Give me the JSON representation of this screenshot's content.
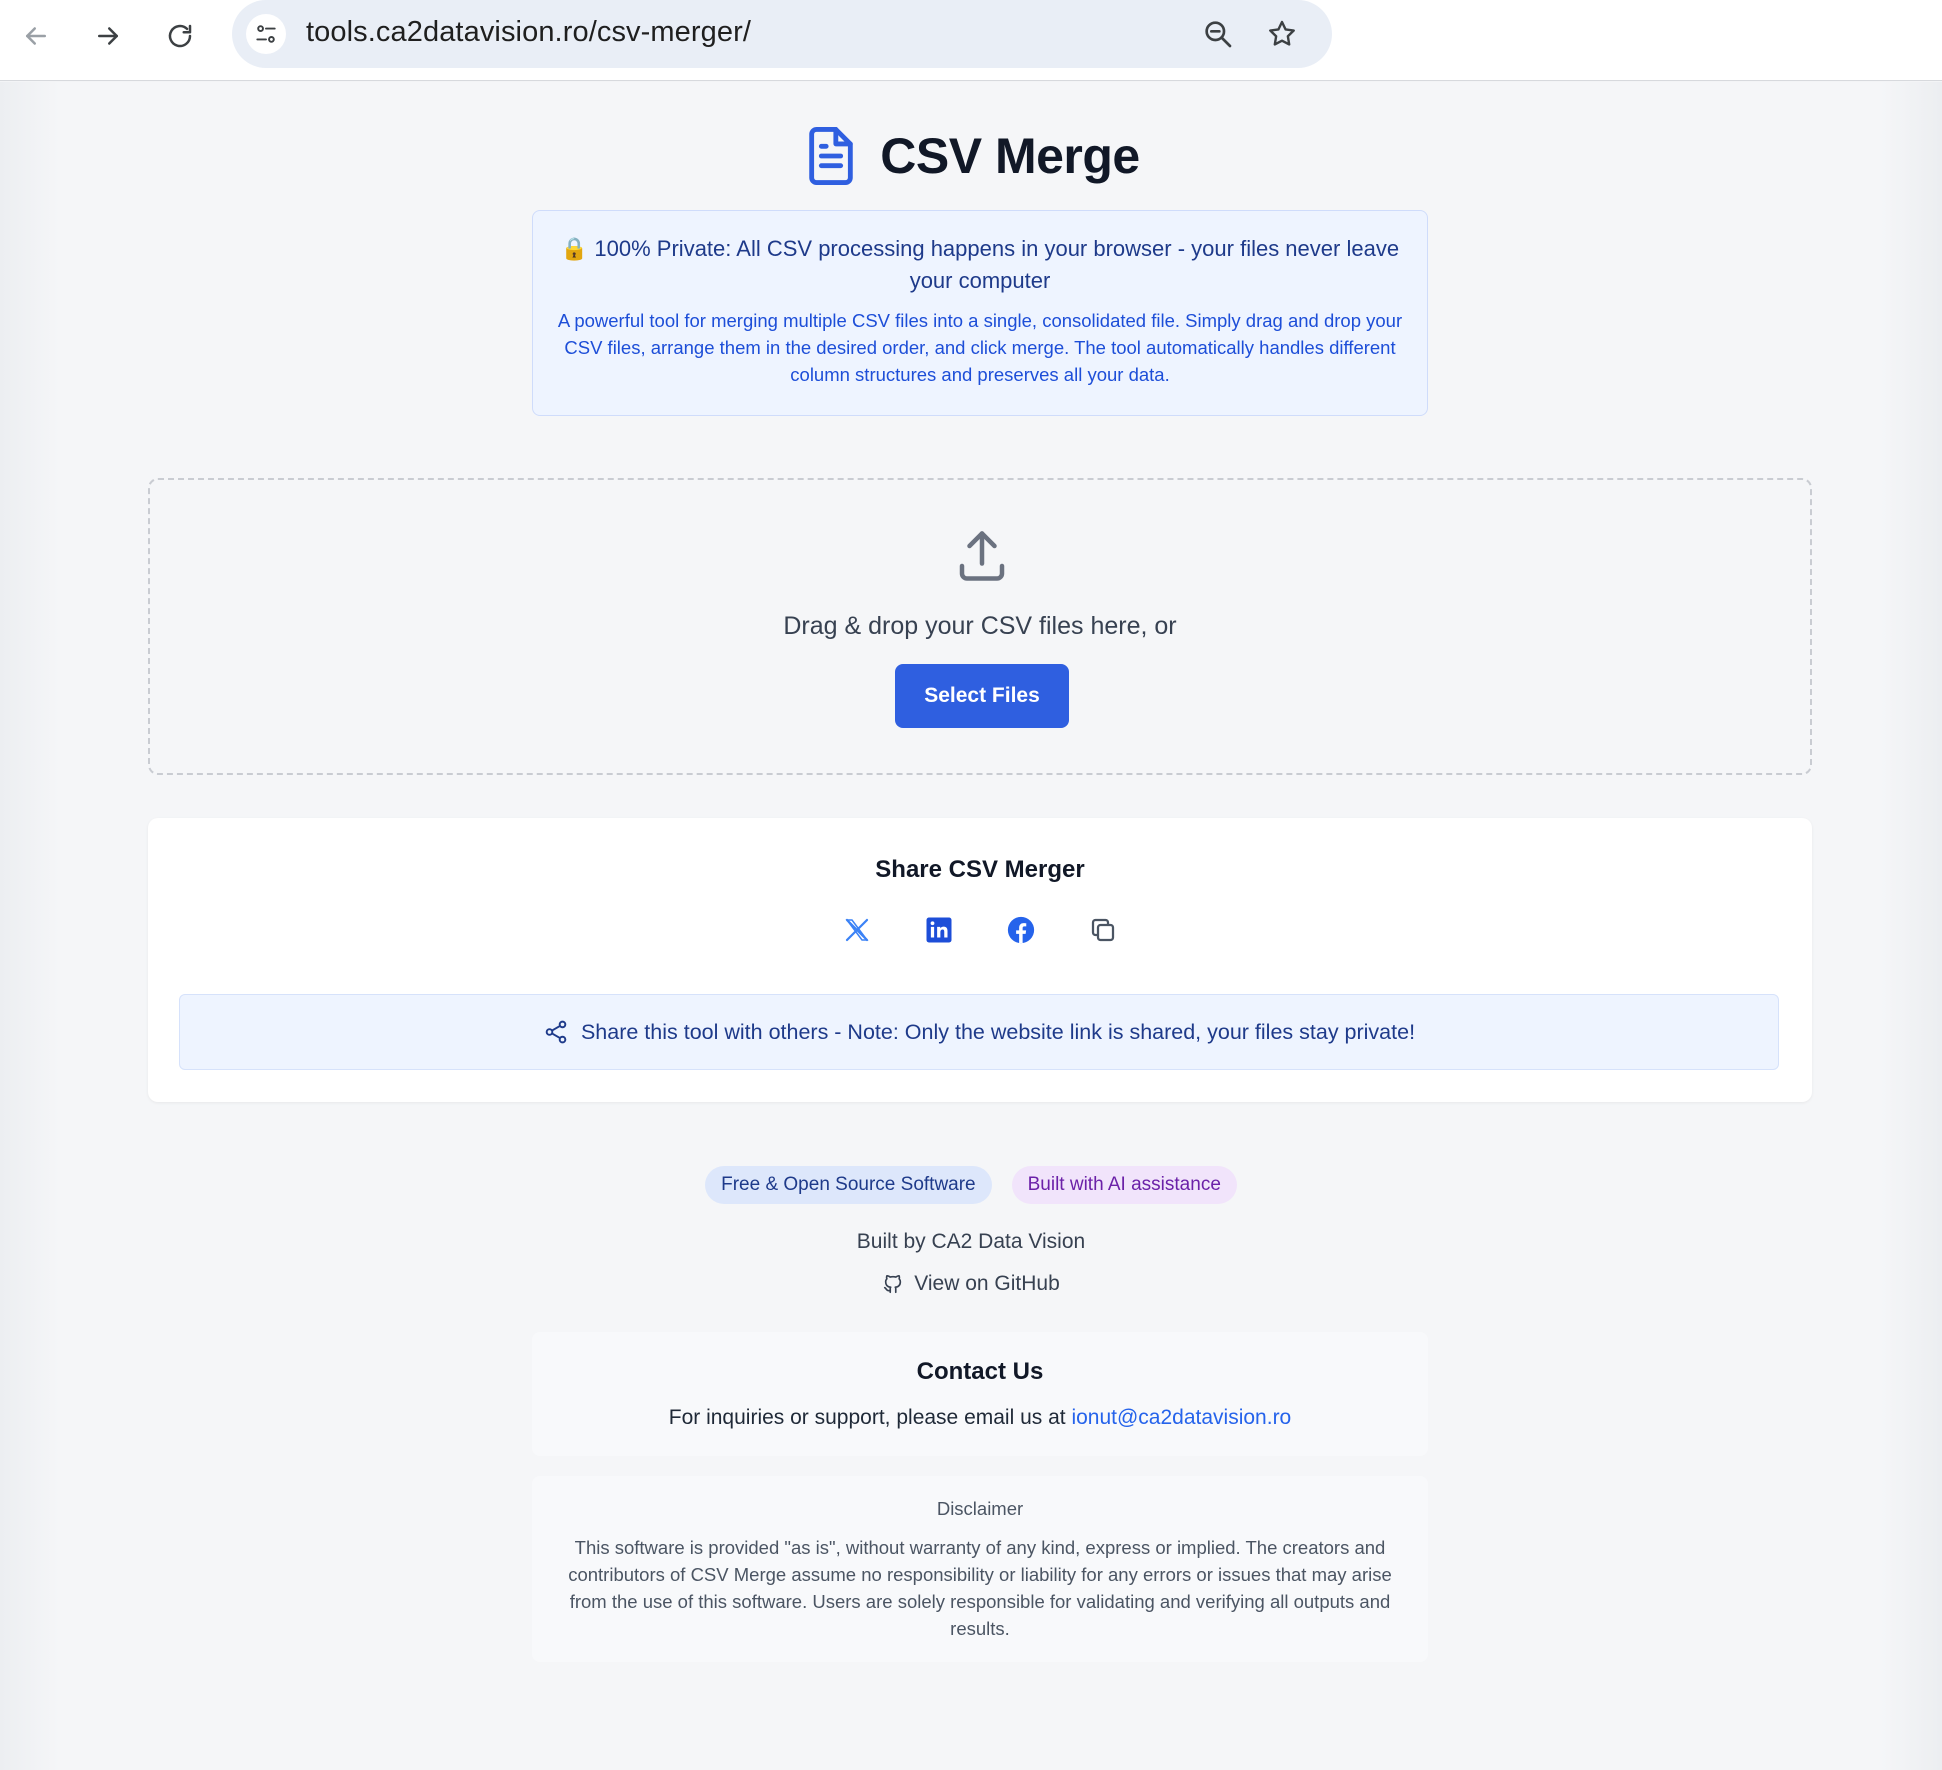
{
  "browser": {
    "url": "tools.ca2datavision.ro/csv-merger/",
    "icons": [
      "back-arrow-icon",
      "forward-arrow-icon",
      "reload-icon",
      "site-settings-icon",
      "zoom-icon",
      "bookmark-star-icon"
    ]
  },
  "header": {
    "title": "CSV Merge",
    "icon": "document-icon"
  },
  "privacy": {
    "headline": "🔒 100% Private: All CSV processing happens in your browser - your files never leave your computer",
    "description": "A powerful tool for merging multiple CSV files into a single, consolidated file. Simply drag and drop your CSV files, arrange them in the desired order, and click merge. The tool automatically handles different column structures and preserves all your data."
  },
  "dropzone": {
    "text": "Drag & drop your CSV files here, or",
    "button_label": "Select Files",
    "icon": "upload-icon"
  },
  "share": {
    "title": "Share CSV Merger",
    "icons": [
      "x-twitter-icon",
      "linkedin-icon",
      "facebook-icon",
      "copy-link-icon"
    ],
    "note": "Share this tool with others - Note: Only the website link is shared, your files stay private!"
  },
  "footer": {
    "badges": [
      "Free & Open Source Software",
      "Built with AI assistance"
    ],
    "built_by": "Built by CA2 Data Vision",
    "github_label": "View on GitHub"
  },
  "contact": {
    "title": "Contact Us",
    "text": "For inquiries or support, please email us at ",
    "email": "ionut@ca2datavision.ro"
  },
  "disclaimer": {
    "title": "Disclaimer",
    "text": "This software is provided \"as is\", without warranty of any kind, express or implied. The creators and contributors of CSV Merge assume no responsibility or liability for any errors or issues that may arise from the use of this software. Users are solely responsible for validating and verifying all outputs and results."
  },
  "colors": {
    "accent": "#2f5fe0",
    "privacy_bg": "#eef4ff",
    "badge_blue_bg": "#dde7fb",
    "badge_purple_bg": "#f1e4fb"
  }
}
